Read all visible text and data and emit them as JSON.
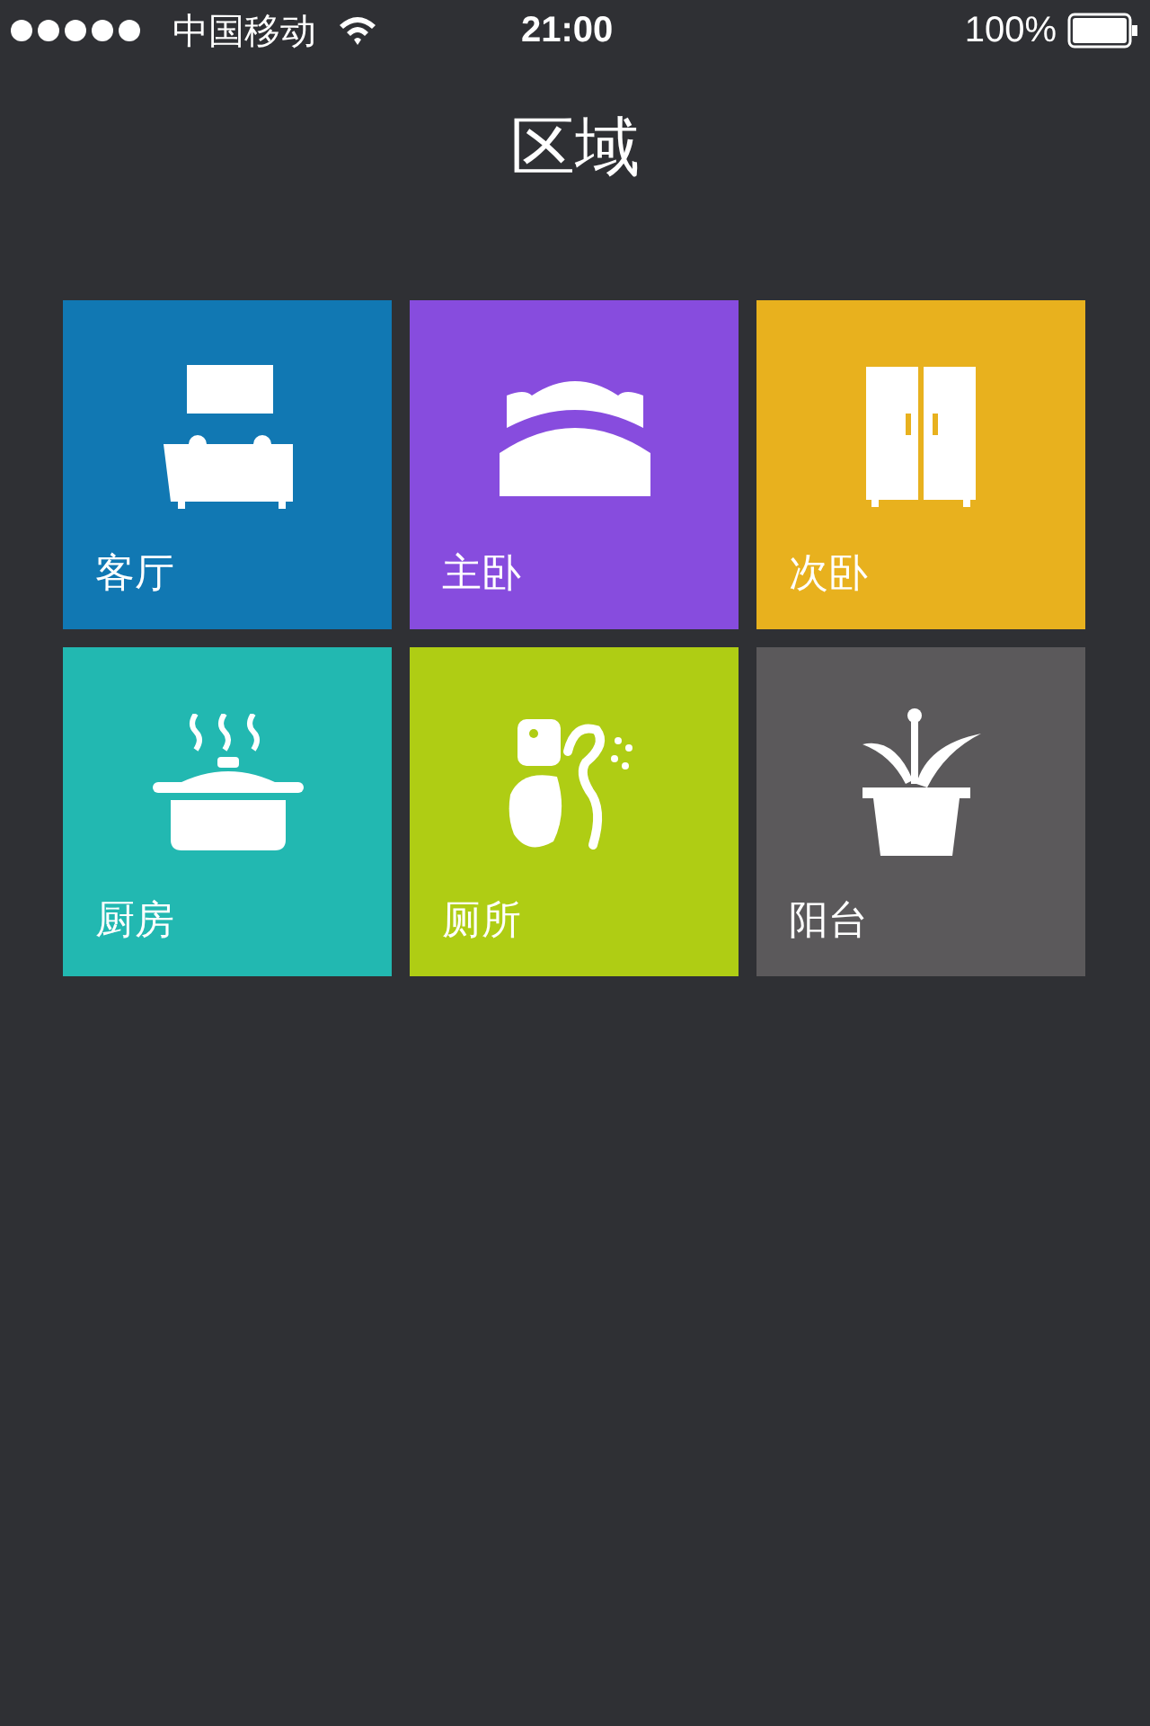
{
  "status_bar": {
    "carrier": "中国移动",
    "time": "21:00",
    "battery": "100%"
  },
  "title": "区域",
  "rooms": [
    {
      "label": "客厅",
      "kind": "sofa",
      "color": "#1178b3"
    },
    {
      "label": "主卧",
      "kind": "bed",
      "color": "#874cde"
    },
    {
      "label": "次卧",
      "kind": "wardrobe",
      "color": "#e8b11e"
    },
    {
      "label": "厨房",
      "kind": "pot",
      "color": "#22b8b1"
    },
    {
      "label": "厕所",
      "kind": "toilet",
      "color": "#afcd14"
    },
    {
      "label": "阳台",
      "kind": "plant",
      "color": "#5b595b"
    }
  ]
}
